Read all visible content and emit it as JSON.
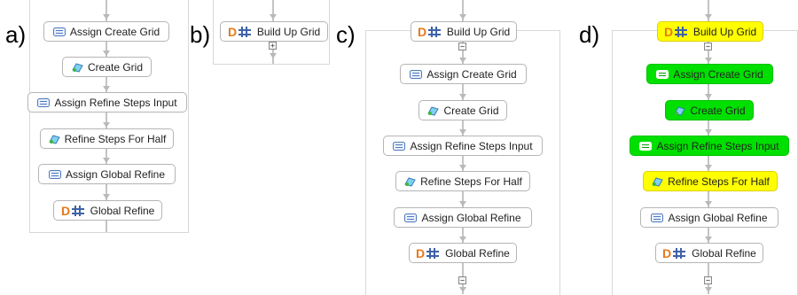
{
  "panels": {
    "a": "a)",
    "b": "b)",
    "c": "c)",
    "d": "d)"
  },
  "nodes": {
    "build_up_grid": "Build Up Grid",
    "assign_create_grid": "Assign Create Grid",
    "create_grid": "Create Grid",
    "assign_refine_steps_input": "Assign Refine Steps Input",
    "refine_steps_for_half": "Refine Steps For Half",
    "assign_global_refine": "Assign Global Refine",
    "global_refine": "Global Refine"
  },
  "toggles": {
    "expand": "+",
    "collapse": "−"
  },
  "icons": {
    "assign": "assign-icon",
    "script": "script-icon",
    "subworkflow": "subworkflow-icon"
  },
  "colors": {
    "executed": "#00e000",
    "running": "#ffff00",
    "d_letter": "#e8781a",
    "hash_blue": "#3f62a8"
  }
}
